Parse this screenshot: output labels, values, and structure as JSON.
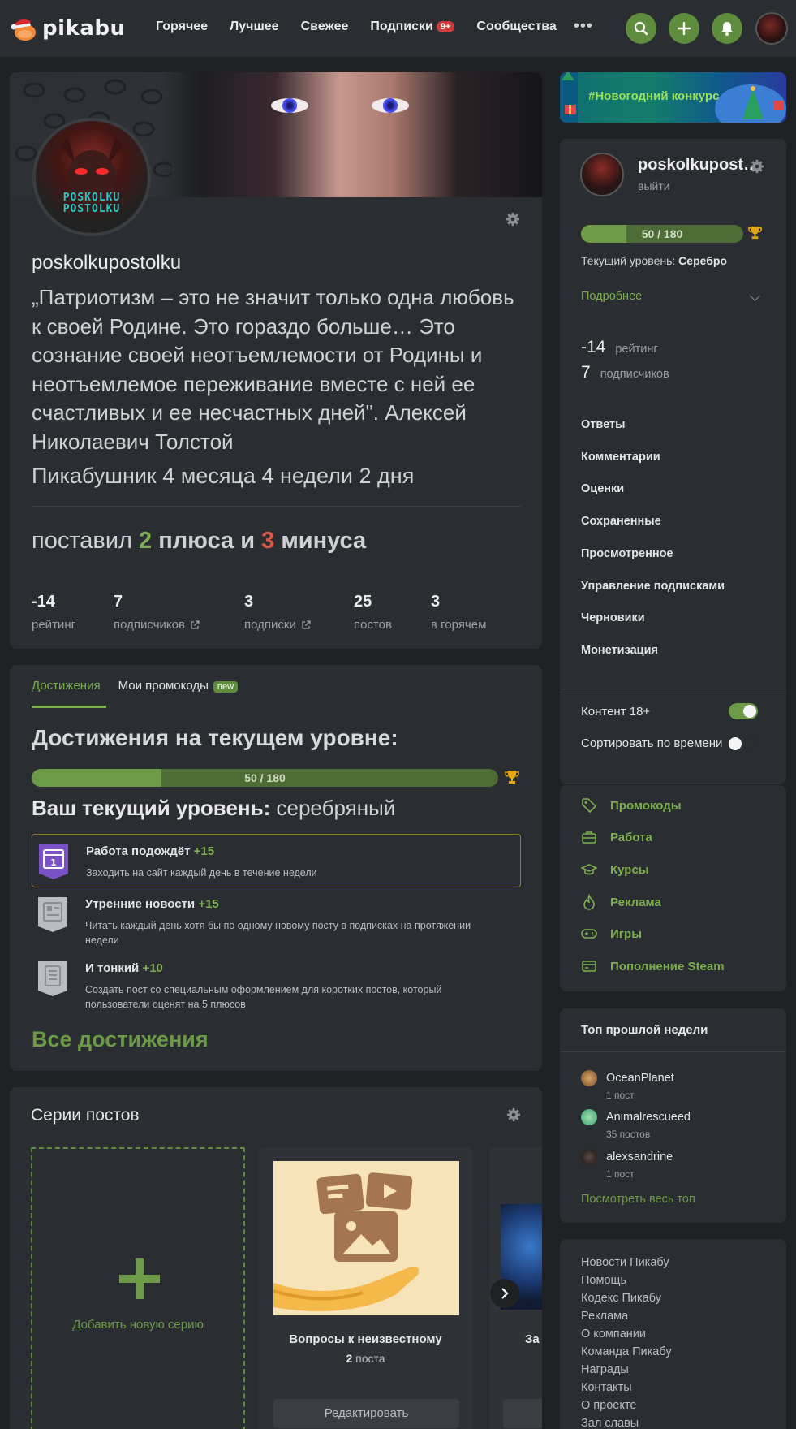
{
  "header": {
    "logo": "pikabu",
    "nav": [
      {
        "label": "Горячее"
      },
      {
        "label": "Лучшее"
      },
      {
        "label": "Свежее"
      },
      {
        "label": "Подписки",
        "badge": "9+"
      },
      {
        "label": "Сообщества"
      }
    ],
    "more_icon": "more-dots-icon",
    "actions": [
      "search-icon",
      "plus-icon",
      "bell-icon"
    ]
  },
  "profile": {
    "username": "poskolkupostolku",
    "avatar_text": "POSKOLKU POSTOLKU",
    "quote": "„Патриотизм – это не значит только одна любовь к своей Родине. Это гораздо больше… Это сознание своей неотъемлемости от Родины и неотъемлемое переживание вместе с ней ее счастливых и ее несчастных дней\". Алексей Николаевич Толстой",
    "age": "Пикабушник 4 месяца 4 недели 2 дня",
    "votes": {
      "prefix": "поставил",
      "plus_count": "2",
      "plus_word": "плюса и",
      "minus_count": "3",
      "minus_word": "минуса"
    },
    "stats": [
      {
        "value": "-14",
        "label": "рейтинг",
        "link": false
      },
      {
        "value": "7",
        "label": "подписчиков",
        "link": true
      },
      {
        "value": "3",
        "label": "подписки",
        "link": true
      },
      {
        "value": "25",
        "label": "постов",
        "link": false
      },
      {
        "value": "3",
        "label": "в горячем",
        "link": false
      }
    ]
  },
  "achievements": {
    "tabs": [
      {
        "label": "Достижения",
        "active": true
      },
      {
        "label": "Мои промокоды",
        "badge": "new",
        "active": false
      }
    ],
    "title": "Достижения на текущем уровне:",
    "progress": {
      "text": "50 / 180",
      "current": 50,
      "max": 180
    },
    "level_label": "Ваш текущий уровень:",
    "level_value": "серебряный",
    "items": [
      {
        "title": "Работа подождёт",
        "points": "+15",
        "desc": "Заходить на сайт каждый день в течение недели",
        "highlighted": true,
        "icon": "calendar-badge-icon"
      },
      {
        "title": "Утренние новости",
        "points": "+15",
        "desc": "Читать каждый день хотя бы по одному новому посту в подписках на протяжении недели",
        "highlighted": false,
        "icon": "newspaper-badge-icon"
      },
      {
        "title": "И тонкий",
        "points": "+10",
        "desc": "Создать пост со специальным оформлением для коротких постов, который пользователи оценят на 5 плюсов",
        "highlighted": false,
        "icon": "document-badge-icon"
      }
    ],
    "all_link": "Все достижения"
  },
  "series": {
    "title": "Серии постов",
    "add_label": "Добавить новую серию",
    "items": [
      {
        "name": "Вопросы к неизвестному",
        "count": "2",
        "count_word": "поста",
        "edit": "Редактировать"
      }
    ],
    "partial_name": "За",
    "next_icon": "chevron-right-icon"
  },
  "sidebar": {
    "promo": "#Новогодний конкурс",
    "user": {
      "name": "poskolkupost…",
      "logout": "выйти"
    },
    "progress": {
      "text": "50 / 180",
      "current": 50,
      "max": 180
    },
    "level_label": "Текущий уровень:",
    "level_value": "Серебро",
    "more": "Подробнее",
    "rating": {
      "value": "-14",
      "label": "рейтинг"
    },
    "subscribers": {
      "value": "7",
      "label": "подписчиков"
    },
    "menu": [
      "Ответы",
      "Комментарии",
      "Оценки",
      "Сохраненные",
      "Просмотренное",
      "Управление подписками",
      "Черновики",
      "Монетизация"
    ],
    "toggles": [
      {
        "label": "Контент 18+",
        "on": true
      },
      {
        "label": "Сортировать по времени",
        "on": false
      }
    ],
    "links": [
      {
        "label": "Промокоды",
        "icon": "tag-icon"
      },
      {
        "label": "Работа",
        "icon": "briefcase-icon"
      },
      {
        "label": "Курсы",
        "icon": "graduation-cap-icon"
      },
      {
        "label": "Реклама",
        "icon": "flame-icon"
      },
      {
        "label": "Игры",
        "icon": "gamepad-icon"
      },
      {
        "label": "Пополнение Steam",
        "icon": "card-icon"
      }
    ],
    "top": {
      "title": "Топ прошлой недели",
      "users": [
        {
          "name": "OceanPlanet",
          "count": "1 пост"
        },
        {
          "name": "Animalrescueed",
          "count": "35 постов"
        },
        {
          "name": "alexsandrine",
          "count": "1 пост"
        }
      ],
      "see_all": "Посмотреть весь топ"
    },
    "footer": [
      "Новости Пикабу",
      "Помощь",
      "Кодекс Пикабу",
      "Реклама",
      "О компании",
      "Команда Пикабу",
      "Награды",
      "Контакты",
      "О проекте",
      "Зал славы"
    ]
  },
  "colors": {
    "accent": "#6c9a47",
    "minus": "#e05848",
    "highlight_border": "#8d7a2f"
  }
}
